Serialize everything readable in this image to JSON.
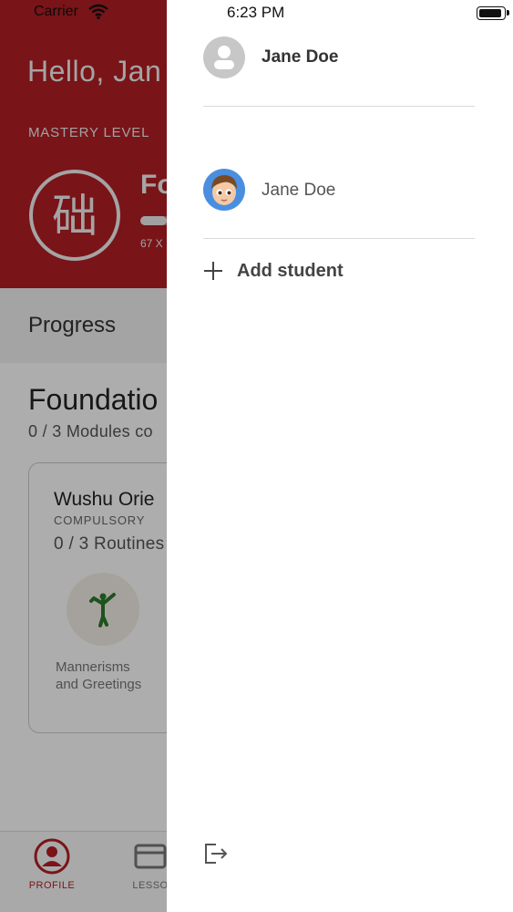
{
  "status_bar": {
    "carrier": "Carrier",
    "time": "6:23 PM"
  },
  "background": {
    "greeting": "Hello, Jan",
    "mastery_label": "MASTERY LEVEL",
    "level_name": "Fo",
    "xp_text": "67 X",
    "level_progress_fraction": 0.18,
    "progress_title": "Progress",
    "section_title": "Foundatio",
    "section_sub": "0 / 3 Modules co",
    "module": {
      "title": "Wushu Orie",
      "tag": "COMPULSORY",
      "progress": "0 / 3 Routines",
      "lesson_label_line1": "Mannerisms",
      "lesson_label_line2": "and Greetings"
    },
    "tabs": {
      "profile": "PROFILE",
      "lessons": "LESSO"
    }
  },
  "drawer": {
    "account_name": "Jane Doe",
    "student_name": "Jane Doe",
    "add_student_label": "Add student"
  },
  "colors": {
    "brand_red": "#b31e24",
    "drawer_bg": "#ffffff",
    "overlay": "rgba(0,0,0,0.32)"
  }
}
